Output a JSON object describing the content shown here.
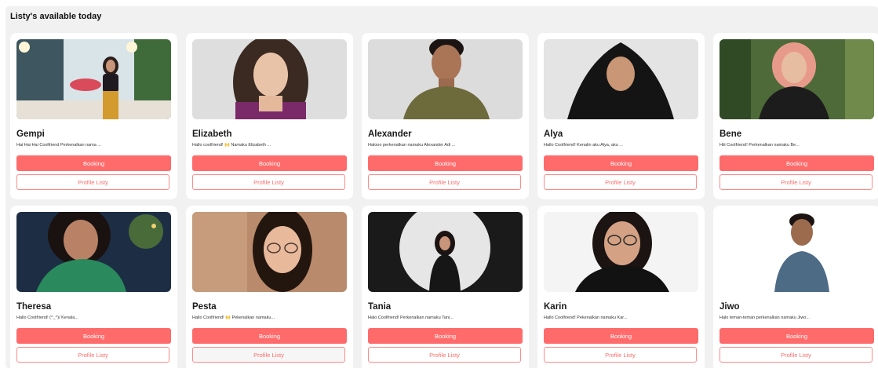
{
  "section": {
    "title": "Listy's available today"
  },
  "listies": [
    {
      "name": "Gempi",
      "description": "Hai Hai Hai Coolfriend Perkenalkan nama ...",
      "booking_label": "Booking",
      "profile_label": "Profile Listy"
    },
    {
      "name": "Elizabeth",
      "description": "Hallo coolfriend! 🙌 Namaku Elizabeth ...",
      "booking_label": "Booking",
      "profile_label": "Profile Listy"
    },
    {
      "name": "Alexander",
      "description": "Halooo perkenalkan namaku Alexander Adi ...",
      "booking_label": "Booking",
      "profile_label": "Profile Listy"
    },
    {
      "name": "Alya",
      "description": "Hallo Coolfriend! Kenalin aku Alya, aku ...",
      "booking_label": "Booking",
      "profile_label": "Profile Listy"
    },
    {
      "name": "Bene",
      "description": "Hiii Coolfriend! Perkenalkan namaku Be...",
      "booking_label": "Booking",
      "profile_label": "Profile Listy"
    },
    {
      "name": "Theresa",
      "description": "Hallo Coolfriend! (^_^)/ Kenala...",
      "booking_label": "Booking",
      "profile_label": "Profile Listy"
    },
    {
      "name": "Pesta",
      "description": "Hallo Coolfriend! 🙌 Pekenalkan namaku...",
      "booking_label": "Booking",
      "profile_label": "Profile Listy"
    },
    {
      "name": "Tania",
      "description": "Halo Coolfriend! Perkenalkan namaku Tani...",
      "booking_label": "Booking",
      "profile_label": "Profile Listy"
    },
    {
      "name": "Karin",
      "description": "Hallo Coolfriend! Pekenalkan namaku Kar...",
      "booking_label": "Booking",
      "profile_label": "Profile Listy"
    },
    {
      "name": "Jiwo",
      "description": "Halo teman-teman perkenalkan namaku Jiwo...",
      "booking_label": "Booking",
      "profile_label": "Profile Listy"
    }
  ],
  "colors": {
    "accent": "#ff6b6b",
    "panel": "#f1f1f1",
    "card": "#ffffff"
  }
}
